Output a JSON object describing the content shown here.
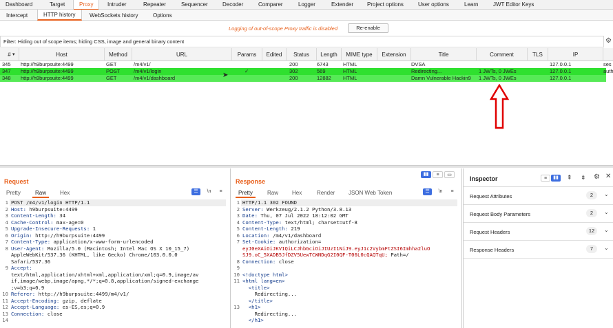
{
  "main_tabs": [
    "Dashboard",
    "Target",
    "Proxy",
    "Intruder",
    "Repeater",
    "Sequencer",
    "Decoder",
    "Comparer",
    "Logger",
    "Extender",
    "Project options",
    "User options",
    "Learn",
    "JWT Editor Keys"
  ],
  "sub_tabs": [
    "Intercept",
    "HTTP history",
    "WebSockets history",
    "Options"
  ],
  "log_notice": "Logging of out-of-scope Proxy traffic is disabled",
  "reenable_label": "Re-enable",
  "filter_text": "Filter: Hiding out of scope items;  hiding CSS, image and general binary content",
  "columns": [
    "#",
    "Host",
    "Method",
    "URL",
    "Params",
    "Edited",
    "Status",
    "Length",
    "MIME type",
    "Extension",
    "Title",
    "Comment",
    "TLS",
    "IP"
  ],
  "rows": [
    {
      "num": "345",
      "host": "http://h9burpsuite:4499",
      "method": "GET",
      "url": "/m4/v1/",
      "params": "",
      "status": "200",
      "length": "6743",
      "mime": "HTML",
      "title": "DVSA",
      "comment": "",
      "ip": "127.0.0.1",
      "extra": "ses"
    },
    {
      "num": "347",
      "host": "http://h9burpsuite:4499",
      "method": "POST",
      "url": "/m4/v1/login",
      "params": "✓",
      "status": "302",
      "length": "569",
      "mime": "HTML",
      "title": "Redirecting...",
      "comment": "1 JWTs, 0 JWEs",
      "ip": "127.0.0.1",
      "extra": "auth"
    },
    {
      "num": "348",
      "host": "http://h9burpsuite:4499",
      "method": "GET",
      "url": "/m4/v1/dashboard",
      "params": "",
      "status": "200",
      "length": "12882",
      "mime": "HTML",
      "title": "Damn Vulnerable Hackin9",
      "comment": "1 JWTs, 0 JWEs",
      "ip": "127.0.0.1",
      "extra": ""
    }
  ],
  "colors": {
    "accent": "#e8601c",
    "row_highlight": "#2fe02f",
    "row_highlight2": "#56ea56",
    "arrow": "#e00000"
  },
  "request": {
    "title": "Request",
    "tabs": [
      "Pretty",
      "Raw",
      "Hex"
    ],
    "newline_label": "\\n",
    "lines": [
      {
        "n": "1",
        "k": "",
        "v": "POST /m4/v1/login HTTP/1.1"
      },
      {
        "n": "2",
        "k": "Host:",
        "v": " h9burpsuite:4499"
      },
      {
        "n": "3",
        "k": "Content-Length:",
        "v": " 34"
      },
      {
        "n": "4",
        "k": "Cache-Control:",
        "v": " max-age=0"
      },
      {
        "n": "5",
        "k": "Upgrade-Insecure-Requests:",
        "v": " 1"
      },
      {
        "n": "6",
        "k": "Origin:",
        "v": " http://h9burpsuite:4499"
      },
      {
        "n": "7",
        "k": "Content-Type:",
        "v": " application/x-www-form-urlencoded"
      },
      {
        "n": "8",
        "k": "User-Agent:",
        "v": " Mozilla/5.0 (Macintosh; Intel Mac OS X 10_15_7)"
      },
      {
        "n": "",
        "k": "",
        "v": "AppleWebKit/537.36 (KHTML, like Gecko) Chrome/103.0.0.0"
      },
      {
        "n": "",
        "k": "",
        "v": "Safari/537.36"
      },
      {
        "n": "9",
        "k": "Accept:",
        "v": ""
      },
      {
        "n": "",
        "k": "",
        "v": "text/html,application/xhtml+xml,application/xml;q=0.9,image/av"
      },
      {
        "n": "",
        "k": "",
        "v": "if,image/webp,image/apng,*/*;q=0.8,application/signed-exchange"
      },
      {
        "n": "",
        "k": "",
        "v": ";v=b3;q=0.9"
      },
      {
        "n": "10",
        "k": "Referer:",
        "v": " http://h9burpsuite:4499/m4/v1/"
      },
      {
        "n": "11",
        "k": "Accept-Encoding:",
        "v": " gzip, deflate"
      },
      {
        "n": "12",
        "k": "Accept-Language:",
        "v": " es-ES,es;q=0.9"
      },
      {
        "n": "13",
        "k": "Connection:",
        "v": " close"
      },
      {
        "n": "14",
        "k": "",
        "v": ""
      }
    ]
  },
  "response": {
    "title": "Response",
    "tabs": [
      "Pretty",
      "Raw",
      "Hex",
      "Render",
      "JSON Web Token"
    ],
    "newline_label": "\\n",
    "lines": [
      {
        "n": "1",
        "k": "",
        "v": "HTTP/1.1 302 FOUND",
        "c": ""
      },
      {
        "n": "2",
        "k": "Server:",
        "v": " Werkzeug/2.1.2 Python/3.8.13",
        "c": ""
      },
      {
        "n": "3",
        "k": "Date:",
        "v": " Thu, 07 Jul 2022 18:12:02 GMT",
        "c": ""
      },
      {
        "n": "4",
        "k": "Content-Type:",
        "v": " text/html; charset=utf-8",
        "c": ""
      },
      {
        "n": "5",
        "k": "Content-Length:",
        "v": " 219",
        "c": ""
      },
      {
        "n": "6",
        "k": "Location:",
        "v": " /m4/v1/dashboard",
        "c": ""
      },
      {
        "n": "7",
        "k": "Set-Cookie:",
        "v": " authorization=",
        "c": ""
      },
      {
        "n": "",
        "k": "",
        "v": "eyJ0eXAiOiJKV1QiLCJhbGciOiJIUzI1NiJ9.eyJ1c2VybmFtZSI6Imhha2luO",
        "c": "sv"
      },
      {
        "n": "",
        "k": "",
        "v": "SJ9.oC_5XADB5JfDZV5UewTCWNDqG2I0QF-T06L0cQAQTqU;",
        "c": "sv",
        "tail": " Path=/"
      },
      {
        "n": "8",
        "k": "Connection:",
        "v": " close",
        "c": ""
      },
      {
        "n": "9",
        "k": "",
        "v": "",
        "c": ""
      },
      {
        "n": "10",
        "k": "",
        "v": "<!doctype html>",
        "c": "k"
      },
      {
        "n": "11",
        "k": "",
        "v": "<html lang=en>",
        "c": "k"
      },
      {
        "n": "",
        "k": "",
        "v": "  <title>",
        "c": "k"
      },
      {
        "n": "",
        "k": "",
        "v": "    Redirecting...",
        "c": ""
      },
      {
        "n": "",
        "k": "",
        "v": "  </title>",
        "c": "k"
      },
      {
        "n": "13",
        "k": "",
        "v": "  <h1>",
        "c": "k"
      },
      {
        "n": "",
        "k": "",
        "v": "    Redirecting...",
        "c": ""
      },
      {
        "n": "",
        "k": "",
        "v": "  </h1>",
        "c": "k"
      }
    ]
  },
  "inspector": {
    "title": "Inspector",
    "sections": [
      {
        "label": "Request Attributes",
        "count": "2"
      },
      {
        "label": "Request Body Parameters",
        "count": "2"
      },
      {
        "label": "Request Headers",
        "count": "12"
      },
      {
        "label": "Response Headers",
        "count": "7"
      }
    ]
  }
}
